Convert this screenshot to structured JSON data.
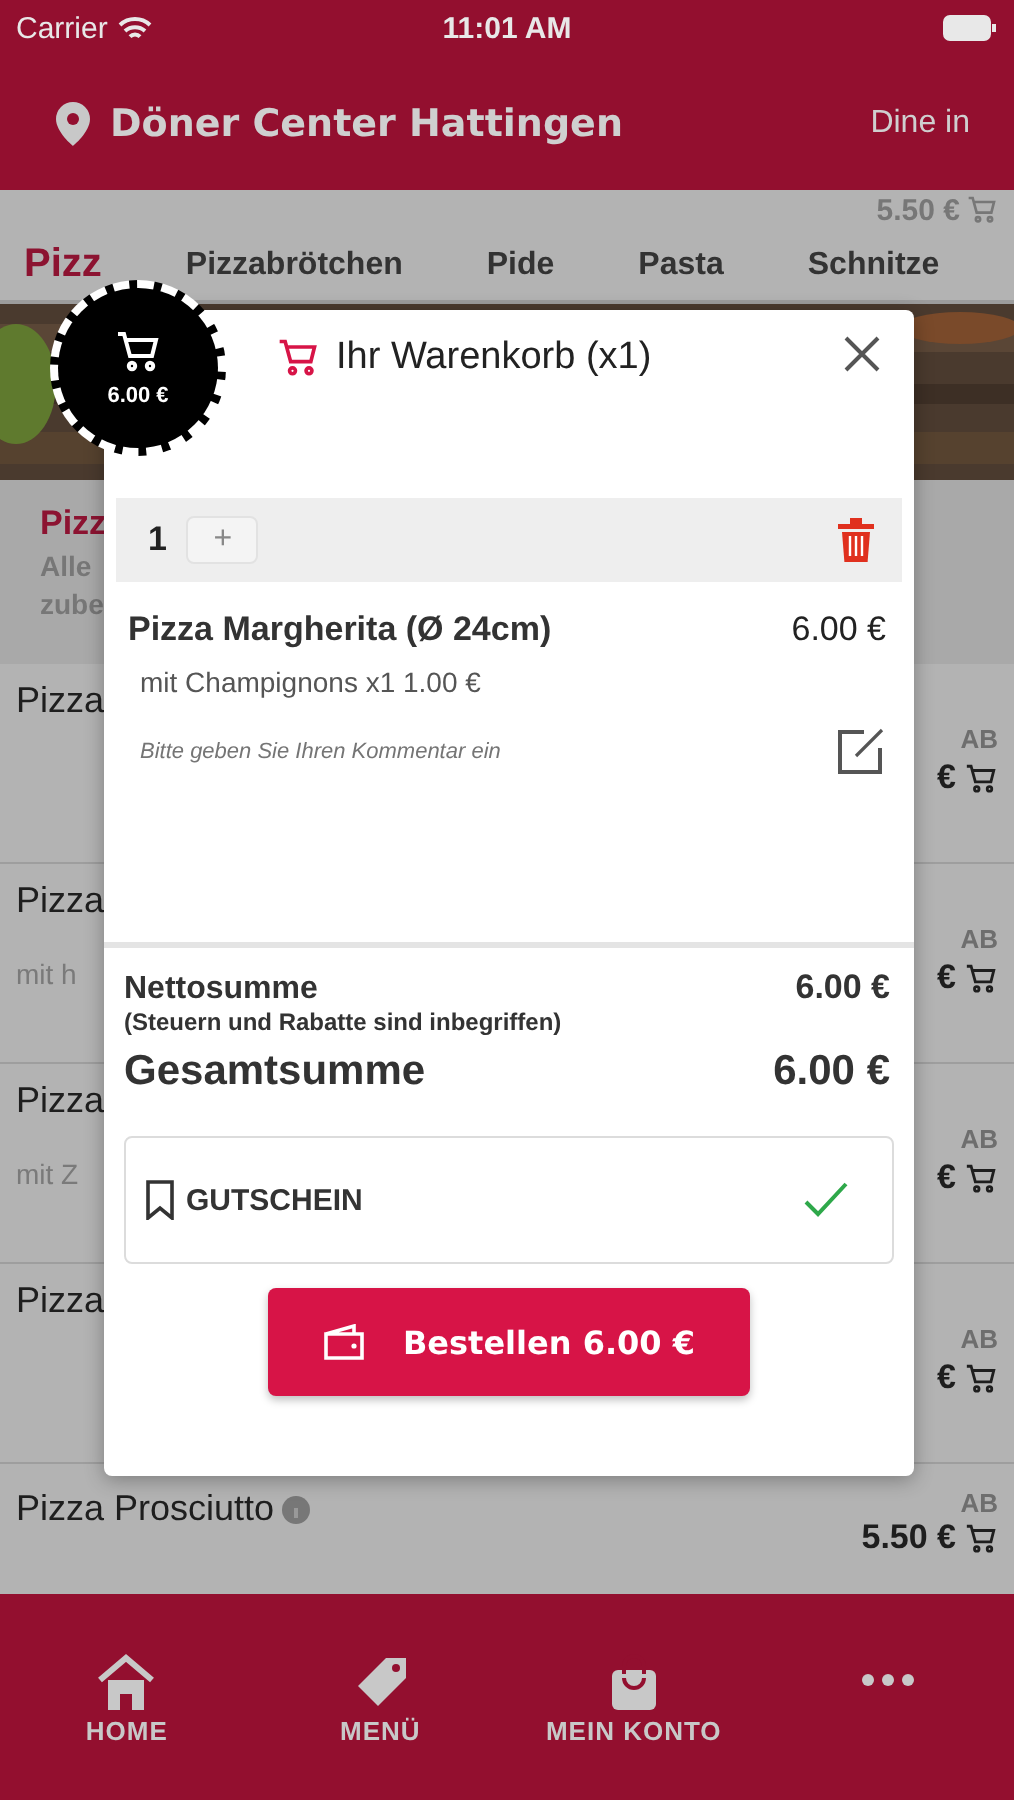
{
  "status_bar": {
    "carrier": "Carrier",
    "time": "11:01 AM"
  },
  "header": {
    "restaurant": "Döner Center Hattingen",
    "mode": "Dine in"
  },
  "hidden_price": "5.50 €",
  "categories": [
    {
      "label": "Pizz",
      "selected": true
    },
    {
      "label": "Pizzabrötchen",
      "selected": false
    },
    {
      "label": "Pide",
      "selected": false
    },
    {
      "label": "Pasta",
      "selected": false
    },
    {
      "label": "Schnitze",
      "selected": false
    }
  ],
  "category_info": {
    "title": "Pizz",
    "lines": [
      "Alle",
      "zube"
    ]
  },
  "products": [
    {
      "name": "Pizza",
      "prefix": "AB",
      "price": "€"
    },
    {
      "name": "Pizza",
      "note": "mit h",
      "prefix": "AB",
      "price": "€"
    },
    {
      "name": "Pizza",
      "note": "mit Z",
      "prefix": "AB",
      "price": "€"
    },
    {
      "name": "Pizza",
      "prefix": "AB",
      "price": "€"
    },
    {
      "name": "Pizza Prosciutto",
      "prefix": "AB",
      "price": "5.50 €",
      "info": true
    }
  ],
  "cart_badge": {
    "total": "6.00 €"
  },
  "cart": {
    "title": "Ihr Warenkorb (x1)",
    "quantity": "1",
    "plus": "+",
    "item": {
      "name": "Pizza Margherita (Ø 24cm)",
      "price": "6.00 €",
      "extra": "mit Champignons x1 1.00 €",
      "comment_placeholder": "Bitte geben Sie Ihren Kommentar ein"
    },
    "net_label": "Nettosumme",
    "net_value": "6.00 €",
    "tax_note": "(Steuern und Rabatte sind inbegriffen)",
    "total_label": "Gesamtsumme",
    "total_value": "6.00 €",
    "coupon": {
      "label": "GUTSCHEIN",
      "checked": true
    },
    "order_button": "Bestellen 6.00 €"
  },
  "bottom_nav": [
    {
      "kind": "home",
      "label": "HOME"
    },
    {
      "kind": "tag",
      "label": "MENÜ"
    },
    {
      "kind": "bag",
      "label": "MEIN KONTO"
    },
    {
      "kind": "more"
    }
  ]
}
